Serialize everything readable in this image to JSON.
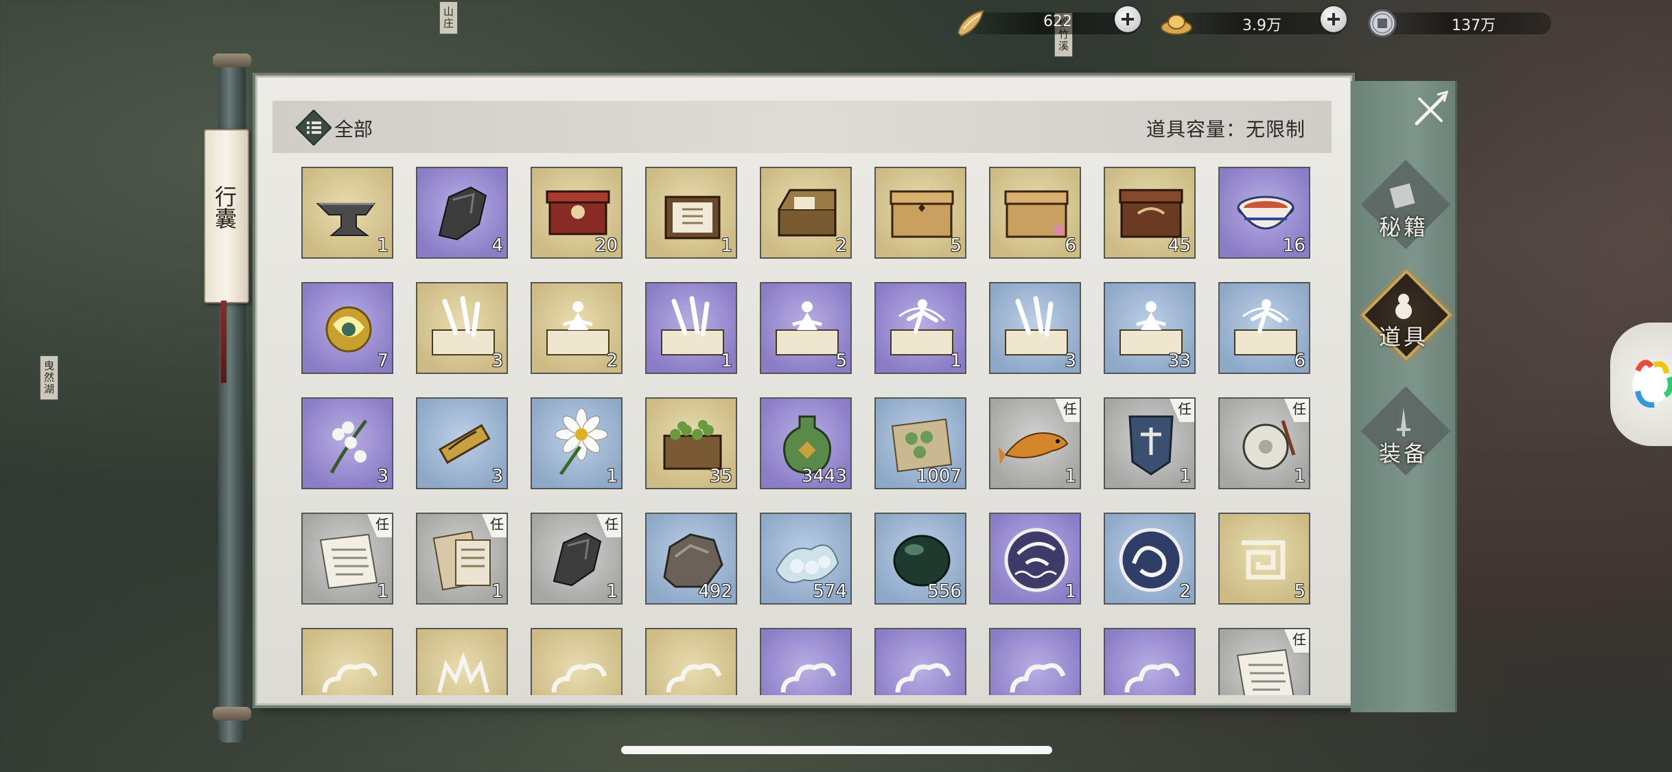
{
  "currencies": [
    {
      "icon": "gold-ingot-shard-icon",
      "value": "622"
    },
    {
      "icon": "gold-ingot-icon",
      "value": "3.9万"
    },
    {
      "icon": "copper-coin-icon",
      "value": "137万"
    }
  ],
  "map_labels": [
    "山庄",
    "松竹溪",
    "曳然湖"
  ],
  "bag_tag": "行囊",
  "header": {
    "category": "全部",
    "capacity": "道具容量：无限制"
  },
  "task_badge": "任",
  "items": [
    {
      "art": "anvil",
      "bg": "tan",
      "qty": "1",
      "task": false
    },
    {
      "art": "iron-ore",
      "bg": "purple",
      "qty": "4",
      "task": false
    },
    {
      "art": "red-chest",
      "bg": "tan",
      "qty": "20",
      "task": false
    },
    {
      "art": "scroll-box",
      "bg": "tan",
      "qty": "1",
      "task": false
    },
    {
      "art": "open-chest",
      "bg": "tan",
      "qty": "2",
      "task": false
    },
    {
      "art": "wood-chest",
      "bg": "tan",
      "qty": "5",
      "task": false
    },
    {
      "art": "flower-chest",
      "bg": "tan",
      "qty": "6",
      "task": false
    },
    {
      "art": "brown-chest",
      "bg": "tan",
      "qty": "45",
      "task": false
    },
    {
      "art": "soup-bowl",
      "bg": "purple",
      "qty": "16",
      "task": false
    },
    {
      "art": "golden-orb",
      "bg": "purple",
      "qty": "7",
      "task": false
    },
    {
      "art": "sword-manual",
      "bg": "tan",
      "qty": "3",
      "task": false
    },
    {
      "art": "meditation-manual",
      "bg": "tan",
      "qty": "2",
      "task": false
    },
    {
      "art": "sword-manual",
      "bg": "purple",
      "qty": "1",
      "task": false
    },
    {
      "art": "meditation-manual",
      "bg": "purple",
      "qty": "5",
      "task": false
    },
    {
      "art": "dance-manual",
      "bg": "purple",
      "qty": "1",
      "task": false
    },
    {
      "art": "sword-manual",
      "bg": "blue",
      "qty": "3",
      "task": false
    },
    {
      "art": "meditation-manual",
      "bg": "blue",
      "qty": "33",
      "task": false
    },
    {
      "art": "dance-manual",
      "bg": "blue",
      "qty": "6",
      "task": false
    },
    {
      "art": "lily-flower",
      "bg": "purple",
      "qty": "3",
      "task": false
    },
    {
      "art": "golden-scroll",
      "bg": "blue",
      "qty": "3",
      "task": false
    },
    {
      "art": "daisy",
      "bg": "blue",
      "qty": "1",
      "task": false
    },
    {
      "art": "bean-crate",
      "bg": "tan",
      "qty": "35",
      "task": false
    },
    {
      "art": "potion-bottle",
      "bg": "purple",
      "qty": "3443",
      "task": false
    },
    {
      "art": "pill-paper",
      "bg": "blue",
      "qty": "1007",
      "task": false
    },
    {
      "art": "gold-fish",
      "bg": "gray",
      "qty": "1",
      "task": true
    },
    {
      "art": "hero-banner",
      "bg": "gray",
      "qty": "1",
      "task": true
    },
    {
      "art": "jade-pendant",
      "bg": "gray",
      "qty": "1",
      "task": true
    },
    {
      "art": "letter",
      "bg": "gray",
      "qty": "1",
      "task": true
    },
    {
      "art": "envelope",
      "bg": "gray",
      "qty": "1",
      "task": true
    },
    {
      "art": "iron-ore",
      "bg": "gray",
      "qty": "1",
      "task": true
    },
    {
      "art": "rock",
      "bg": "blue",
      "qty": "492",
      "task": false
    },
    {
      "art": "silk-cloth",
      "bg": "blue",
      "qty": "574",
      "task": false
    },
    {
      "art": "jade-stone",
      "bg": "blue",
      "qty": "556",
      "task": false
    },
    {
      "art": "crane-token",
      "bg": "purple",
      "qty": "1",
      "task": false
    },
    {
      "art": "dragon-token",
      "bg": "blue",
      "qty": "2",
      "task": false
    },
    {
      "art": "spiral-token",
      "bg": "tan",
      "qty": "5",
      "task": false
    },
    {
      "art": "cloud-token",
      "bg": "tan",
      "qty": "",
      "task": false
    },
    {
      "art": "crown-token",
      "bg": "tan",
      "qty": "",
      "task": false
    },
    {
      "art": "cloud-token",
      "bg": "tan",
      "qty": "",
      "task": false
    },
    {
      "art": "cloud-token",
      "bg": "tan",
      "qty": "",
      "task": false
    },
    {
      "art": "cloud-token",
      "bg": "purple",
      "qty": "",
      "task": false
    },
    {
      "art": "cloud-token",
      "bg": "purple",
      "qty": "",
      "task": false
    },
    {
      "art": "cloud-token",
      "bg": "purple",
      "qty": "",
      "task": false
    },
    {
      "art": "cloud-token",
      "bg": "purple",
      "qty": "",
      "task": false
    },
    {
      "art": "letter",
      "bg": "gray",
      "qty": "",
      "task": true
    }
  ],
  "side_tabs": [
    {
      "label": "秘籍",
      "icon": "book-icon",
      "active": false
    },
    {
      "label": "道具",
      "icon": "gourd-icon",
      "active": true
    },
    {
      "label": "装备",
      "icon": "sword-icon",
      "active": false
    }
  ]
}
